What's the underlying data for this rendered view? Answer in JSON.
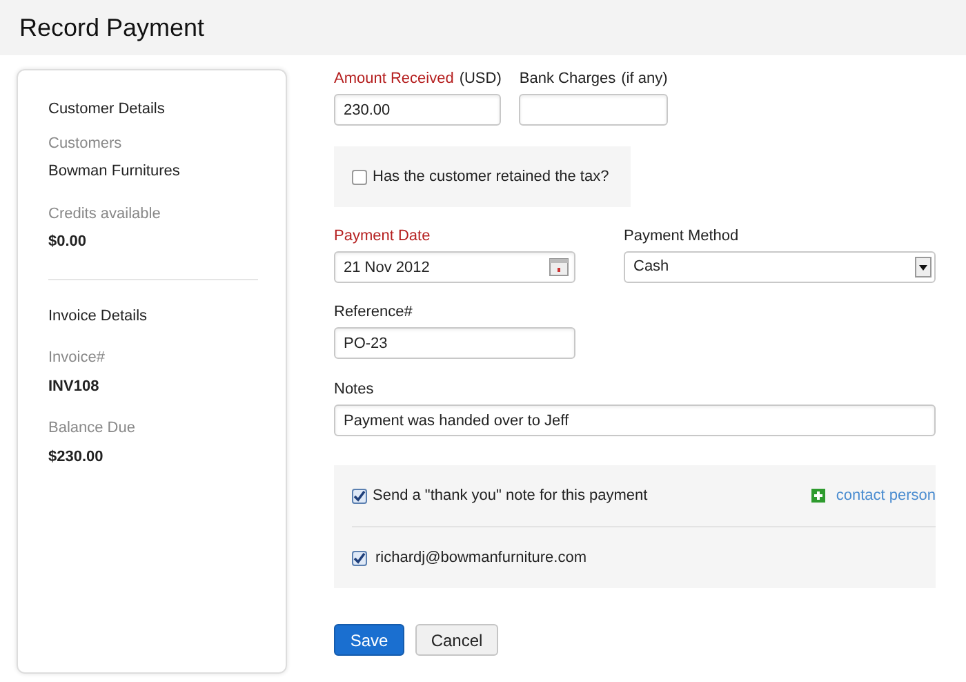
{
  "page": {
    "title": "Record Payment"
  },
  "sidebar": {
    "sections": [
      {
        "heading": "Customer Details",
        "fields": [
          {
            "label": "Customers",
            "value": "Bowman Furnitures",
            "bold": false
          },
          {
            "label": "Credits available",
            "value": "$0.00",
            "bold": true
          }
        ]
      },
      {
        "heading": "Invoice Details",
        "fields": [
          {
            "label": "Invoice#",
            "value": "INV108",
            "bold": true
          },
          {
            "label": "Balance Due",
            "value": "$230.00",
            "bold": true
          }
        ]
      }
    ]
  },
  "amount": {
    "label": "Amount Received",
    "suffix": "(USD)",
    "required": true,
    "value": "230.00"
  },
  "bank_charges": {
    "label": "Bank Charges",
    "suffix": "(if any)",
    "required": false
  },
  "tax_retained": {
    "label": "Has the customer retained the tax?",
    "checked": false
  },
  "payment_date": {
    "label": "Payment Date",
    "required": true,
    "value": "21 Nov 2012"
  },
  "payment_method": {
    "label": "Payment Method",
    "required": false,
    "value": "Cash"
  },
  "reference": {
    "label": "Reference#",
    "required": false,
    "value": "PO-23"
  },
  "notes": {
    "label": "Notes",
    "required": false,
    "value": "Payment was handed over to Jeff"
  },
  "thank_you": {
    "label": "Send a \"thank you\" note for this payment",
    "checked": true,
    "link": "contact person",
    "recipients": [
      {
        "email": "richardj@bowmanfurniture.com",
        "checked": true
      }
    ]
  },
  "buttons": [
    {
      "label": "Save",
      "kind": "primary"
    },
    {
      "label": "Cancel",
      "kind": "secondary"
    }
  ]
}
